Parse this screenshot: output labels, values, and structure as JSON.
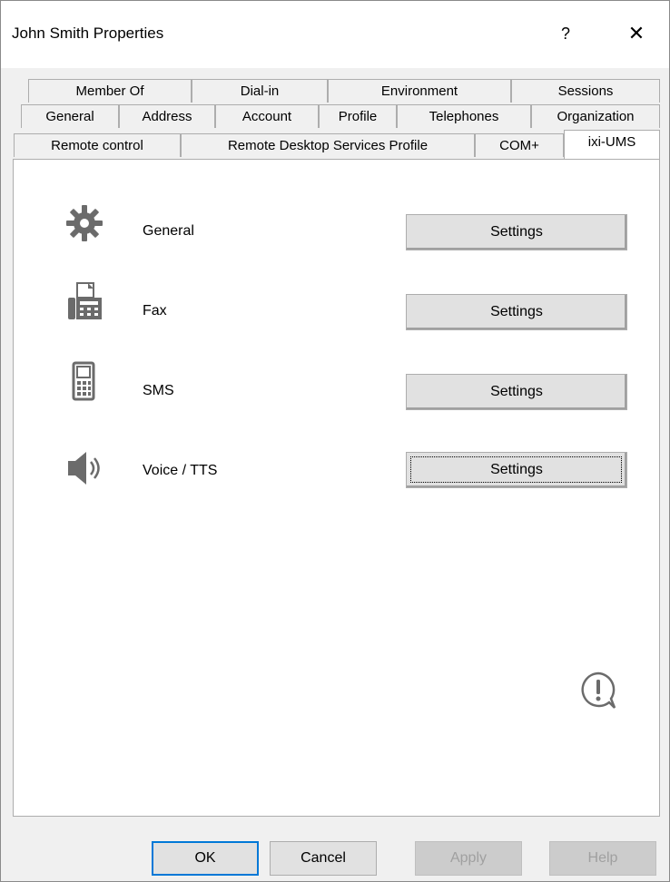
{
  "window": {
    "title": "John Smith Properties",
    "help_label": "?",
    "close_label": "✕"
  },
  "tabs": {
    "row1": [
      "Member Of",
      "Dial-in",
      "Environment",
      "Sessions"
    ],
    "row2": [
      "General",
      "Address",
      "Account",
      "Profile",
      "Telephones",
      "Organization"
    ],
    "row3": [
      "Remote control",
      "Remote Desktop Services Profile",
      "COM+",
      "ixi-UMS"
    ],
    "active": "ixi-UMS"
  },
  "panel": {
    "rows": [
      {
        "label": "General",
        "icon": "gear-icon",
        "button": "Settings"
      },
      {
        "label": "Fax",
        "icon": "fax-icon",
        "button": "Settings"
      },
      {
        "label": "SMS",
        "icon": "mobile-phone-icon",
        "button": "Settings"
      },
      {
        "label": "Voice / TTS",
        "icon": "speaker-icon",
        "button": "Settings"
      }
    ],
    "info_icon": "info-bubble-icon"
  },
  "buttons": {
    "ok": "OK",
    "cancel": "Cancel",
    "apply": "Apply",
    "help": "Help"
  }
}
